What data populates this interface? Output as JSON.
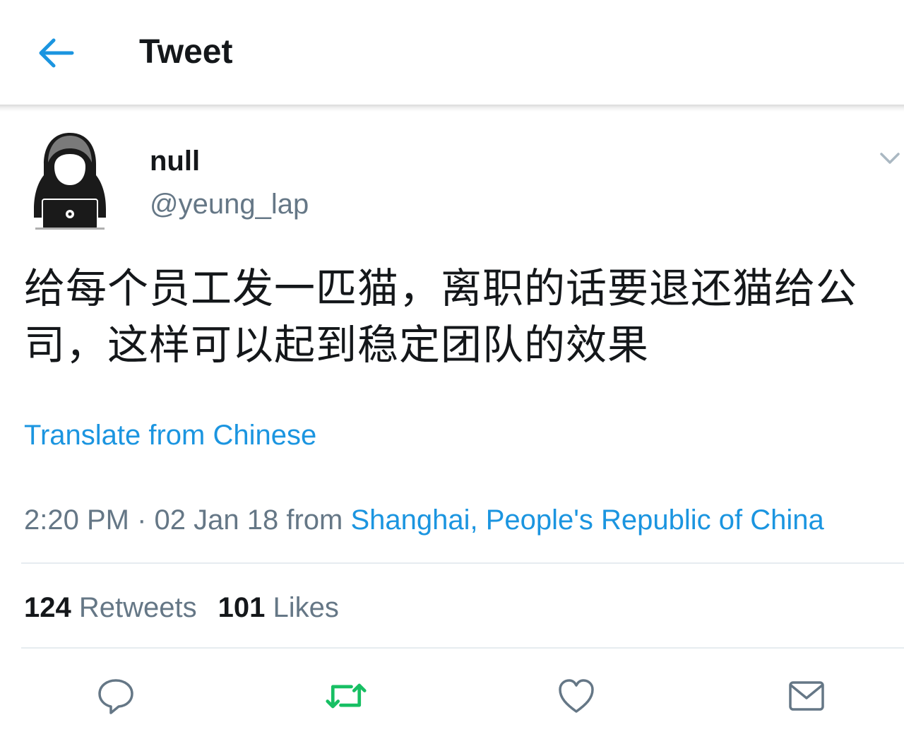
{
  "header": {
    "back_icon": "arrow-left-icon",
    "title": "Tweet"
  },
  "tweet": {
    "author": {
      "display_name": "null",
      "handle": "@yeung_lap",
      "avatar_icon": "hooded-hacker-avatar"
    },
    "menu_icon": "chevron-down-icon",
    "text": "给每个员工发一匹猫，离职的话要退还猫给公司，这样可以起到稳定团队的效果",
    "translate_label": "Translate from Chinese",
    "meta": {
      "time": "2:20 PM",
      "separator": " · ",
      "date": "02 Jan 18",
      "from_label": "from",
      "location": "Shanghai, People's Republic of China"
    },
    "stats": {
      "retweets_count": "124",
      "retweets_label": "Retweets",
      "likes_count": "101",
      "likes_label": "Likes"
    }
  },
  "actions": [
    {
      "name": "reply",
      "icon": "reply-bubble-icon"
    },
    {
      "name": "retweet",
      "icon": "retweet-icon"
    },
    {
      "name": "like",
      "icon": "heart-icon"
    },
    {
      "name": "direct-message",
      "icon": "envelope-icon"
    }
  ],
  "colors": {
    "accent": "#1b95e0",
    "retweet": "#17bf63",
    "secondary_text": "#657786",
    "primary_text": "#14171a",
    "icon_gray": "#657786"
  }
}
